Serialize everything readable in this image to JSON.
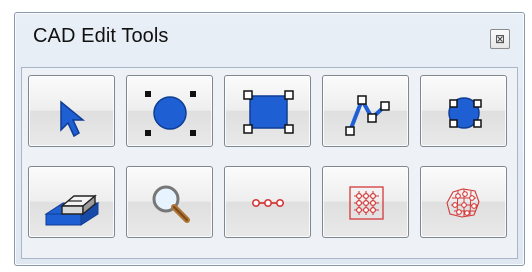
{
  "window": {
    "title": "CAD Edit Tools",
    "close_glyph": "⊠"
  },
  "tools": [
    {
      "icon": "pointer-arrow-icon"
    },
    {
      "icon": "select-circle-icon"
    },
    {
      "icon": "select-rectangle-icon"
    },
    {
      "icon": "polyline-icon"
    },
    {
      "icon": "edit-circle-icon"
    },
    {
      "icon": "eraser-icon"
    },
    {
      "icon": "magnifier-icon"
    },
    {
      "icon": "link-nodes-icon"
    },
    {
      "icon": "group-grid-icon"
    },
    {
      "icon": "scattered-grid-icon"
    }
  ],
  "colors": {
    "accent_blue": "#1f5fd4",
    "handle_black": "#111111",
    "link_red": "#d43a3a",
    "frame_border": "#8a9aad"
  }
}
